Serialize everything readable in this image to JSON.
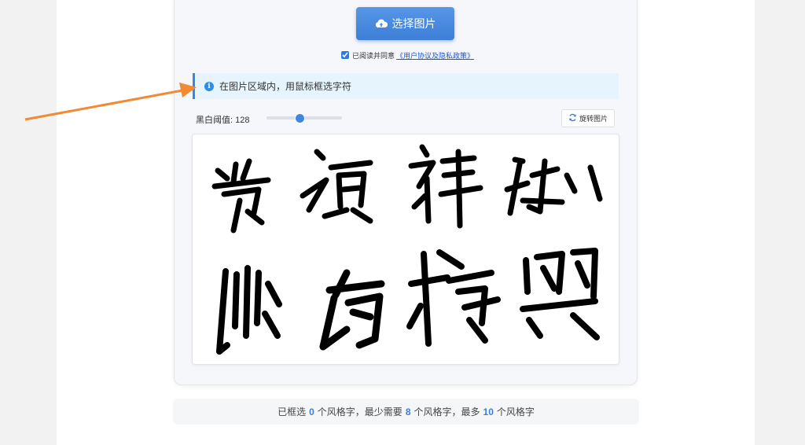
{
  "upload": {
    "label": "选择图片",
    "icon": "cloud-upload-icon"
  },
  "agreement": {
    "checked": true,
    "prefix": "已阅读并同意",
    "link": "《用户协议及隐私政策》"
  },
  "info": {
    "text": "在图片区域内，用鼠标框选字符",
    "icon": "info-icon"
  },
  "threshold": {
    "label": "黑白阈值: 128",
    "value": 128,
    "min": 0,
    "max": 255
  },
  "rotate": {
    "label": "旋转图片",
    "icon": "refresh-icon"
  },
  "status": {
    "selected_prefix": "已框选",
    "selected_count": "0",
    "mid1": "个风格字，最少需要",
    "min_count": "8",
    "mid2": "个风格字，最多",
    "max_count": "10",
    "suffix": "个风格字"
  },
  "colors": {
    "accent": "#3c7fd7",
    "info_bg": "#e6f4fd",
    "arrow": "#f08a35"
  }
}
